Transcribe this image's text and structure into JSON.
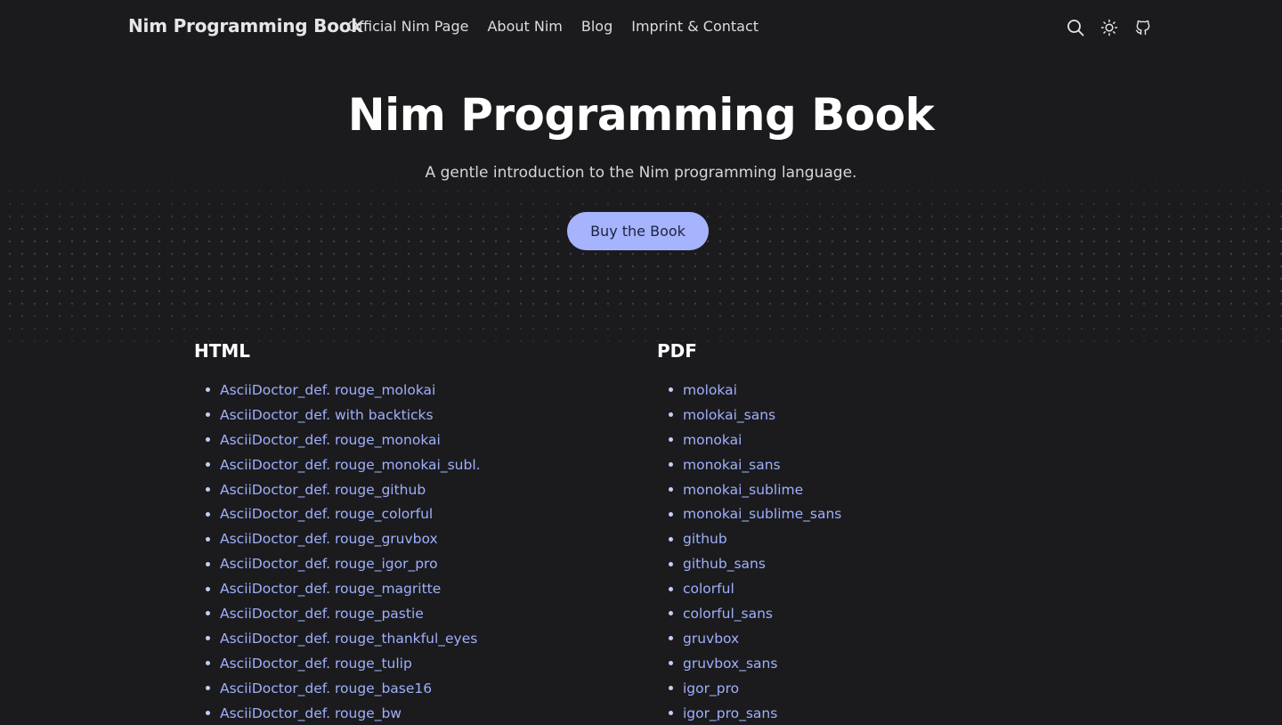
{
  "nav": {
    "brand": "Nim Programming Book",
    "links": [
      "Official Nim Page",
      "About Nim",
      "Blog",
      "Imprint & Contact"
    ],
    "icons": [
      "search-icon",
      "theme-toggle-icon",
      "github-icon"
    ]
  },
  "hero": {
    "title": "Nim Programming Book",
    "subtitle": "A gentle introduction to the Nim programming language.",
    "button_label": "Buy the Book"
  },
  "html_section": {
    "heading": "HTML",
    "items": [
      "AsciiDoctor_def. rouge_molokai",
      "AsciiDoctor_def. with backticks",
      "AsciiDoctor_def. rouge_monokai",
      "AsciiDoctor_def. rouge_monokai_subl.",
      "AsciiDoctor_def. rouge_github",
      "AsciiDoctor_def. rouge_colorful",
      "AsciiDoctor_def. rouge_gruvbox",
      "AsciiDoctor_def. rouge_igor_pro",
      "AsciiDoctor_def. rouge_magritte",
      "AsciiDoctor_def. rouge_pastie",
      "AsciiDoctor_def. rouge_thankful_eyes",
      "AsciiDoctor_def. rouge_tulip",
      "AsciiDoctor_def. rouge_base16",
      "AsciiDoctor_def. rouge_bw"
    ]
  },
  "pdf_section": {
    "heading": "PDF",
    "items": [
      "molokai",
      "molokai_sans",
      "monokai",
      "monokai_sans",
      "monokai_sublime",
      "monokai_sublime_sans",
      "github",
      "github_sans",
      "colorful",
      "colorful_sans",
      "gruvbox",
      "gruvbox_sans",
      "igor_pro",
      "igor_pro_sans"
    ]
  },
  "colors": {
    "background": "#1b1b1e",
    "accent": "#a5b4fc",
    "link": "#9fb0fb"
  }
}
